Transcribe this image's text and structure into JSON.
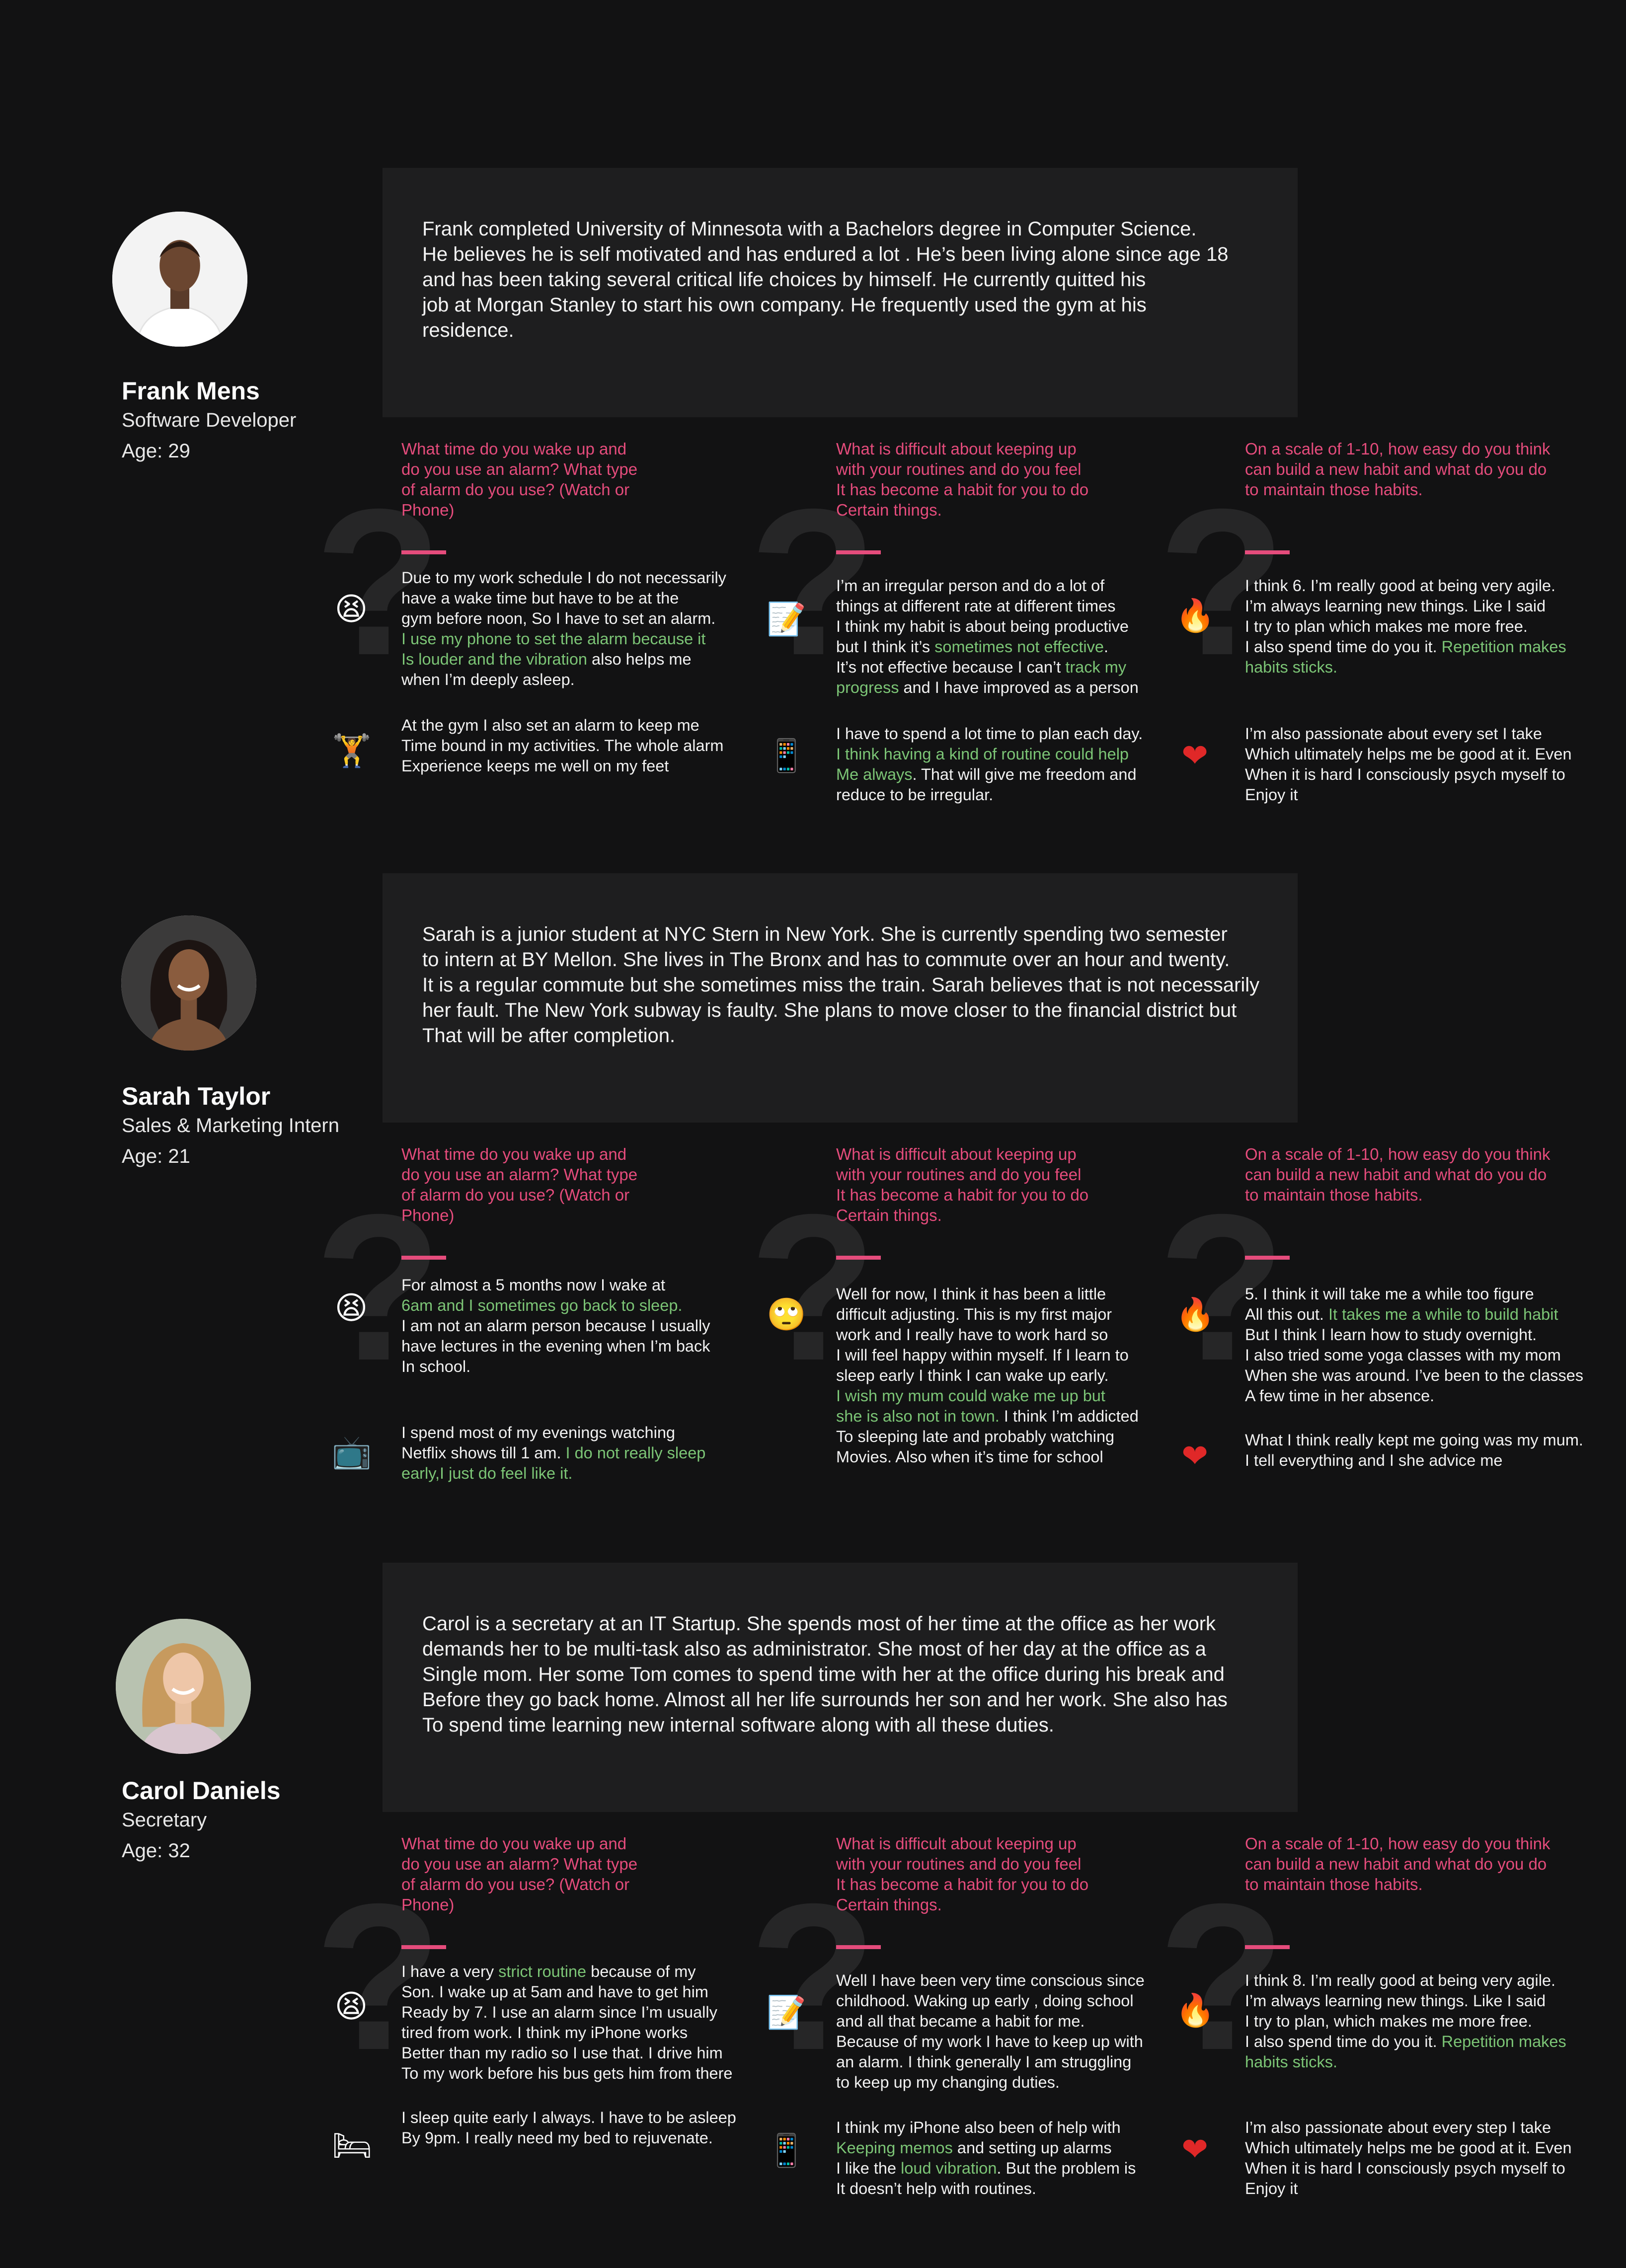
{
  "questions": {
    "q1": "What time do you wake up and\ndo you use an alarm? What type\nof alarm do you use? (Watch or\nPhone)",
    "q2": "What is difficult about keeping up\nwith your routines and do you feel\nIt has become a habit for you to do\nCertain things.",
    "q3": "On a scale of 1-10, how easy do you think\ncan build a new habit and what do you do\nto maintain those habits."
  },
  "colors": {
    "accent": "#e54c7c",
    "highlight": "#7cc576",
    "background": "#121213",
    "card": "#1e1e1f"
  },
  "personas": [
    {
      "name": "Frank Mens",
      "role": "Software Developer",
      "age": "Age: 29",
      "bio": "Frank completed University of Minnesota with a Bachelors degree  in Computer Science.\nHe believes he is self motivated and has endured a lot . He’s been living alone since age 18\nand has been taking several critical life choices by himself. He currently quitted his\njob at Morgan Stanley to start his own company. He frequently used the gym at his\nresidence.",
      "answers": [
        [
          {
            "icon": "tired-face-icon",
            "glyph": "😫",
            "segments": [
              {
                "t": "Due to my work schedule I do not necessarily\nhave a wake time but have to be at the\ngym before noon, So I have to set an alarm.\n"
              },
              {
                "t": "I use my phone to set the alarm because it\nIs louder and the vibration",
                "h": true
              },
              {
                "t": " also helps me\nwhen I’m deeply asleep."
              }
            ]
          },
          {
            "icon": "weightlifter-icon",
            "glyph": "🏋",
            "segments": [
              {
                "t": "At the gym I also set an alarm to keep me\nTime bound in my activities. The whole alarm\nExperience keeps me well on my feet"
              }
            ]
          }
        ],
        [
          {
            "icon": "memo-icon",
            "glyph": "📝",
            "segments": [
              {
                "t": "I’m an irregular person and do a lot of\nthings at different rate at different times\nI think my habit is about being productive\nbut I think it’s "
              },
              {
                "t": "sometimes not effective",
                "h": true
              },
              {
                "t": ".\nIt’s not effective because I can’t "
              },
              {
                "t": "track my\nprogress",
                "h": true
              },
              {
                "t": " and I have improved as a person"
              }
            ]
          },
          {
            "icon": "mobile-phone-icon",
            "glyph": "📱",
            "segments": [
              {
                "t": "I have to spend a lot time to plan each day.\n"
              },
              {
                "t": "I think having a kind of routine could help\nMe always",
                "h": true
              },
              {
                "t": ". That will give me freedom and\nreduce to be irregular."
              }
            ]
          }
        ],
        [
          {
            "icon": "fire-icon",
            "glyph": "🔥",
            "segments": [
              {
                "t": "I think 6. I’m really good at being very agile.\nI’m always learning new things. Like I said\nI try to plan which makes me more free.\nI also spend time do you it. "
              },
              {
                "t": "Repetition makes\nhabits sticks.",
                "h": true
              }
            ]
          },
          {
            "icon": "red-heart-icon",
            "glyph": "❤",
            "segments": [
              {
                "t": "I’m also passionate about every set I take\nWhich ultimately helps me be good at it. Even\nWhen it is hard I consciously psych myself to\nEnjoy it"
              }
            ]
          }
        ]
      ]
    },
    {
      "name": "Sarah Taylor",
      "role": "Sales & Marketing Intern",
      "age": "Age: 21",
      "bio": "Sarah is a junior student at NYC Stern in New York. She is currently spending two semester\nto intern at BY Mellon. She lives in The Bronx and has to commute over an hour and twenty.\nIt is a regular commute but she sometimes miss the train. Sarah believes that is not necessarily\nher fault. The New York subway is faulty. She plans to move closer to the financial district but\nThat will be after completion.",
      "answers": [
        [
          {
            "icon": "tired-face-icon",
            "glyph": "😫",
            "segments": [
              {
                "t": "For almost a 5 months now I wake at\n"
              },
              {
                "t": "6am and I sometimes go back to sleep.",
                "h": true
              },
              {
                "t": "\nI am not an alarm person because I usually\nhave lectures in the evening when I’m back\nIn school."
              }
            ]
          },
          {
            "icon": "television-icon",
            "glyph": "📺",
            "segments": [
              {
                "t": "I spend most of my evenings watching\nNetflix shows till 1 am. "
              },
              {
                "t": "I do not really sleep\nearly,I just do feel like it.",
                "h": true
              }
            ]
          }
        ],
        [
          {
            "icon": "eye-roll-face-icon",
            "glyph": "🙄",
            "segments": [
              {
                "t": "Well for now, I think it has been a little\ndifficult adjusting. This is my first major\nwork and I really have to work hard so\nI will feel happy within myself. If I learn to\nsleep early I think I can wake up early.\n"
              },
              {
                "t": "I wish my mum could wake me up but\nshe is also not in town.",
                "h": true
              },
              {
                "t": " I think I’m addicted\nTo sleeping late and probably watching\nMovies. Also when it’s time for school"
              }
            ]
          }
        ],
        [
          {
            "icon": "fire-icon",
            "glyph": "🔥",
            "segments": [
              {
                "t": "5. I think it will take me a while too figure\nAll this out. "
              },
              {
                "t": "It takes me a while to build habit",
                "h": true
              },
              {
                "t": "\nBut I think I learn how to study overnight.\nI also tried some yoga classes with my mom\nWhen she was around. I’ve been to the classes\nA few time in her absence."
              }
            ]
          },
          {
            "icon": "red-heart-icon",
            "glyph": "❤",
            "segments": [
              {
                "t": "What I think really kept me going was my mum.\nI tell everything and I she advice me"
              }
            ]
          }
        ]
      ]
    },
    {
      "name": "Carol Daniels",
      "role": "Secretary",
      "age": "Age: 32",
      "bio": "Carol is a secretary at an IT Startup. She spends most of her time at the office as her work\ndemands her to be multi-task also as  administrator.  She most of her day at the office as a\nSingle mom. Her some Tom comes to spend time with her at the office during his break and\nBefore they go back home. Almost all her life surrounds her son and her work. She also has\nTo spend time learning new internal software along with all these duties.",
      "answers": [
        [
          {
            "icon": "tired-face-icon",
            "glyph": "😫",
            "segments": [
              {
                "t": "I have a very "
              },
              {
                "t": "strict routine",
                "h": true
              },
              {
                "t": " because of my\nSon. I wake up at 5am and have to get him\nReady by 7. I use an alarm since I’m usually\ntired from work. I think my iPhone works\nBetter than my radio so I use that. I drive him\nTo my work before his bus gets him from there"
              }
            ]
          },
          {
            "icon": "bed-icon",
            "glyph": "🛏",
            "segments": [
              {
                "t": "I sleep quite early I always. I have to be asleep\nBy 9pm. I really need my bed to rejuvenate."
              }
            ]
          }
        ],
        [
          {
            "icon": "memo-icon",
            "glyph": "📝",
            "segments": [
              {
                "t": "Well I have been very time conscious since\nchildhood. Waking up early , doing school\nand all that became a habit for me.\nBecause of my work I have to keep up with\nan alarm. I think generally I am struggling\nto keep up my changing duties."
              }
            ]
          },
          {
            "icon": "mobile-phone-icon",
            "glyph": "📱",
            "segments": [
              {
                "t": "I think my iPhone also been of help with\n"
              },
              {
                "t": "Keeping memos",
                "h": true
              },
              {
                "t": " and setting up alarms\nI like the "
              },
              {
                "t": "loud vibration",
                "h": true
              },
              {
                "t": ". But the problem is\nIt doesn’t help with routines."
              }
            ]
          }
        ],
        [
          {
            "icon": "fire-icon",
            "glyph": "🔥",
            "segments": [
              {
                "t": "I think 8. I’m really good at being very agile.\nI’m always learning new things. Like I said\nI try to plan, which makes me more free.\nI also spend time do you it. "
              },
              {
                "t": "Repetition makes\nhabits sticks.",
                "h": true
              }
            ]
          },
          {
            "icon": "red-heart-icon",
            "glyph": "❤",
            "segments": [
              {
                "t": "I’m also passionate about every step I take\nWhich ultimately helps me be good at it. Even\nWhen it is hard I consciously psych myself to\nEnjoy it"
              }
            ]
          }
        ]
      ]
    }
  ]
}
